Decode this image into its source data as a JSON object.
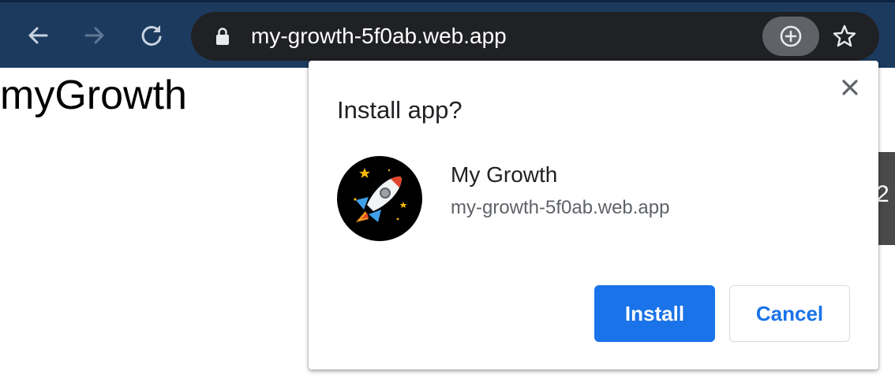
{
  "browser": {
    "url": "my-growth-5f0ab.web.app",
    "icons": {
      "back": "arrow-left-icon",
      "forward": "arrow-right-icon",
      "reload": "reload-icon",
      "lock": "lock-icon",
      "install": "install-plus-icon",
      "bookmark": "star-icon"
    },
    "colors": {
      "toolbar": "#1c3a5e",
      "omnibox": "#202124"
    }
  },
  "page": {
    "title": "myGrowth",
    "side_tab_text": "2"
  },
  "dialog": {
    "title": "Install app?",
    "app_name": "My Growth",
    "app_origin": "my-growth-5f0ab.web.app",
    "install_label": "Install",
    "cancel_label": "Cancel",
    "app_icon": "rocket-icon",
    "colors": {
      "primary": "#1a73e8"
    }
  }
}
